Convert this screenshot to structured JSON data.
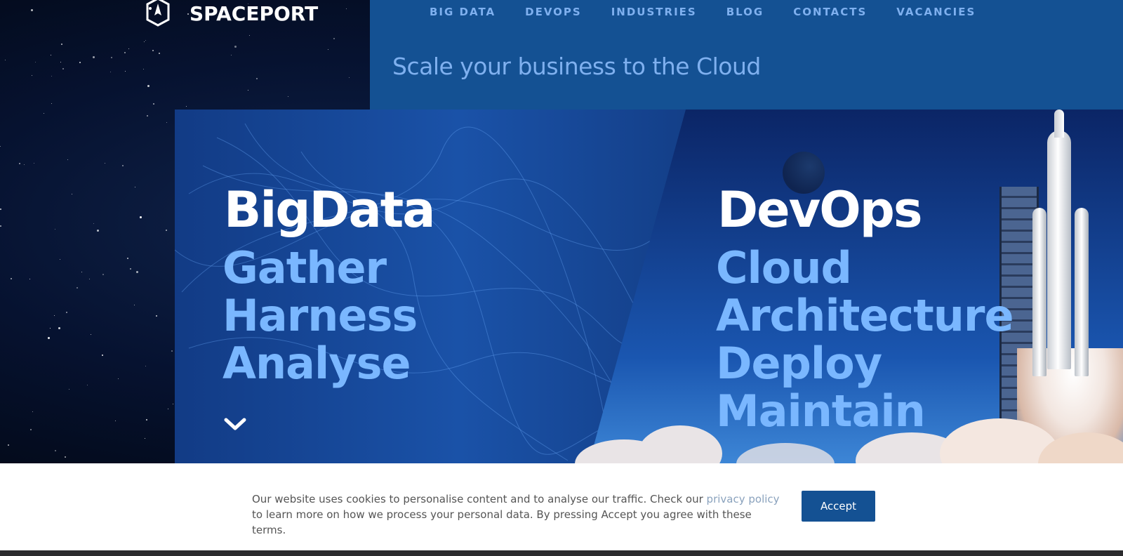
{
  "brand": {
    "name": "SPACEPORT",
    "logo_icon": "rocket-shield-logo"
  },
  "nav": {
    "items": [
      {
        "label": "BIG DATA"
      },
      {
        "label": "DEVOPS"
      },
      {
        "label": "INDUSTRIES"
      },
      {
        "label": "BLOG"
      },
      {
        "label": "CONTACTS"
      },
      {
        "label": "VACANCIES"
      }
    ]
  },
  "tagline": "Scale your business to the Cloud",
  "hero": {
    "left": {
      "title": "BigData",
      "lines": [
        "Gather",
        "Harness",
        "Analyse"
      ]
    },
    "right": {
      "title": "DevOps",
      "lines": [
        "Cloud",
        "Architecture",
        "Deploy",
        "Maintain"
      ]
    },
    "scroll_icon": "chevron-down-icon"
  },
  "cookie": {
    "text_before": "Our website uses cookies to personalise content and to analyse our traffic. Check our ",
    "link_label": "privacy policy",
    "text_after": " to learn more on how we process your personal data. By pressing Accept you agree with these terms.",
    "accept_label": "Accept"
  },
  "colors": {
    "accent": "#145193",
    "light_blue": "#7ab7ff"
  }
}
